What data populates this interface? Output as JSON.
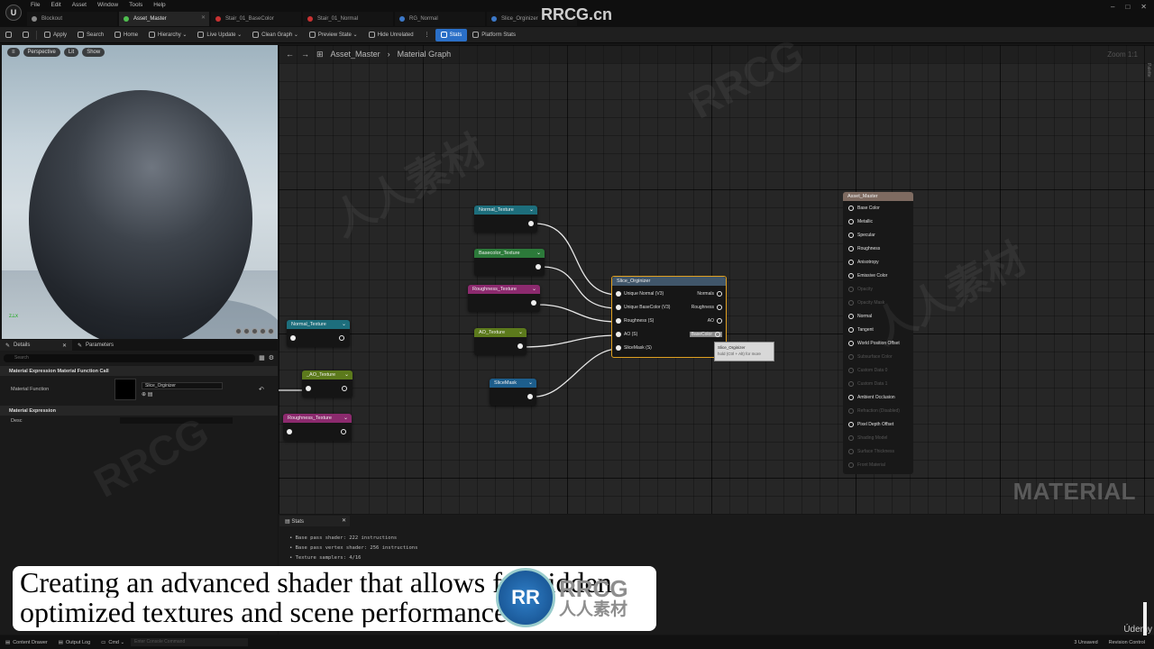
{
  "menu": [
    "File",
    "Edit",
    "Asset",
    "Window",
    "Tools",
    "Help"
  ],
  "tabs": [
    {
      "label": "Blockout",
      "color": "#8a8a8a",
      "active": false
    },
    {
      "label": "Asset_Master",
      "color": "#4fbf4f",
      "active": true
    },
    {
      "label": "Stair_01_BaseColor",
      "color": "#c83232",
      "active": false
    },
    {
      "label": "Stair_01_Normal",
      "color": "#c83232",
      "active": false
    },
    {
      "label": "RG_Normal",
      "color": "#3c78c8",
      "active": false
    },
    {
      "label": "Slice_Orginizer",
      "color": "#3c78c8",
      "active": false
    }
  ],
  "toolbar": {
    "apply": "Apply",
    "search": "Search",
    "home": "Home",
    "hierarchy": "Hierarchy ⌄",
    "live_update": "Live Update ⌄",
    "clean_graph": "Clean Graph ⌄",
    "preview_state": "Preview State ⌄",
    "hide_unrelated": "Hide Unrelated",
    "stats": "Stats",
    "platform_stats": "Platform Stats"
  },
  "viewport": {
    "perspective": "Perspective",
    "lit": "Lit",
    "show": "Show"
  },
  "details": {
    "tab_details": "Details",
    "tab_parameters": "Parameters",
    "search_placeholder": "Search",
    "section_call": "Material Expression Material Function Call",
    "label_function": "Material Function",
    "function_value": "Slice_Orginizer",
    "section_expr": "Material Expression",
    "label_desc": "Desc"
  },
  "graph": {
    "crumb_root": "Asset_Master",
    "crumb_child": "Material Graph",
    "zoom": "Zoom 1:1",
    "palette": "Palette",
    "watermark": "MATERIAL",
    "texture_nodes": [
      {
        "label": "Normal_Texture",
        "color": "#1d6e7c"
      },
      {
        "label": "Basecolor_Texture",
        "color": "#2c7a3a"
      },
      {
        "label": "Roughness_Texture",
        "color": "#8c2a6e"
      },
      {
        "label": "AO_Texture",
        "color": "#5c7a1c"
      },
      {
        "label": "SliceMask",
        "color": "#1d5e8c"
      },
      {
        "label": "Normal_Texture",
        "color": "#1d6e7c"
      },
      {
        "label": "_AO_Texture",
        "color": "#5c7a1c"
      },
      {
        "label": "Roughness_Texture",
        "color": "#8c2a6e"
      }
    ],
    "slice_node": {
      "title": "Slice_Orginizer",
      "inputs": [
        "Unique Normal (V3)",
        "Unique BaseColor (V3)",
        "Roughness (S)",
        "AO (S)",
        "SliceMask (S)"
      ],
      "outputs": [
        "Normals",
        "Roughness",
        "AO",
        "BaseColor"
      ]
    },
    "tooltip": {
      "title": "Slice_Orginizer",
      "hint": "hold (Ctrl + Alt) for more"
    },
    "master": {
      "title": "Asset_Master",
      "pins": [
        {
          "label": "Base Color",
          "on": true
        },
        {
          "label": "Metallic",
          "on": true
        },
        {
          "label": "Specular",
          "on": true
        },
        {
          "label": "Roughness",
          "on": true
        },
        {
          "label": "Anisotropy",
          "on": true
        },
        {
          "label": "Emissive Color",
          "on": true
        },
        {
          "label": "Opacity",
          "on": false
        },
        {
          "label": "Opacity Mask",
          "on": false
        },
        {
          "label": "Normal",
          "on": true
        },
        {
          "label": "Tangent",
          "on": true
        },
        {
          "label": "World Position Offset",
          "on": true
        },
        {
          "label": "Subsurface Color",
          "on": false
        },
        {
          "label": "Custom Data 0",
          "on": false
        },
        {
          "label": "Custom Data 1",
          "on": false
        },
        {
          "label": "Ambient Occlusion",
          "on": true
        },
        {
          "label": "Refraction (Disabled)",
          "on": false
        },
        {
          "label": "Pixel Depth Offset",
          "on": true
        },
        {
          "label": "Shading Model",
          "on": false
        },
        {
          "label": "Surface Thickness",
          "on": false
        },
        {
          "label": "Front Material",
          "on": false
        }
      ]
    }
  },
  "stats": {
    "tab": "Stats",
    "lines": [
      "Base pass shader: 222 instructions",
      "Base pass vertex shader: 256 instructions",
      "Texture samplers: 4/16"
    ]
  },
  "caption": {
    "line1": "Creating an advanced shader that allows for hidden",
    "line2": "optimized textures and scene performance!"
  },
  "brand": {
    "logo": "RR",
    "name": "RRCG",
    "cn": "人人素材"
  },
  "site": "RRCG.cn",
  "statusbar": {
    "content_drawer": "Content Drawer",
    "output_log": "Output Log",
    "cmd": "Cmd ⌄",
    "console_placeholder": "Enter Console Command",
    "unsaved": "3 Unsaved",
    "revision": "Revision Control",
    "udemy": "Údemy"
  }
}
